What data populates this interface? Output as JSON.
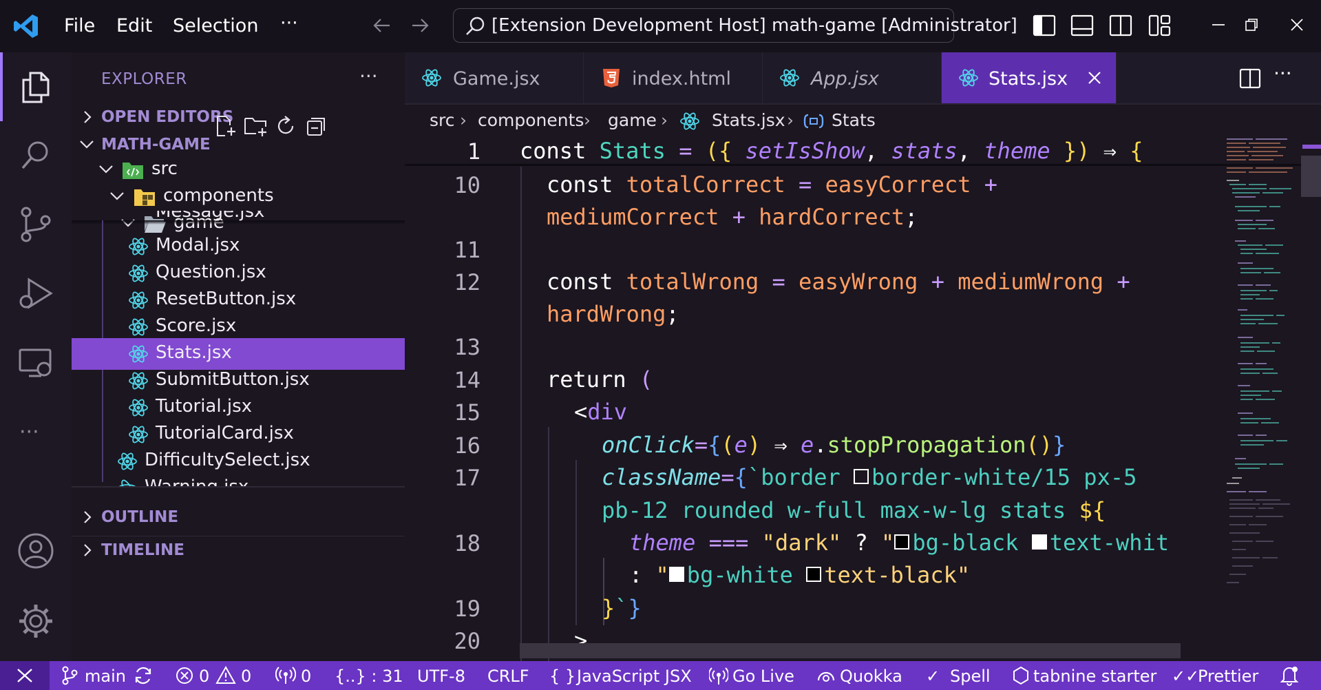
{
  "titlebar": {
    "menu": [
      "File",
      "Edit",
      "Selection"
    ],
    "more": "···",
    "command_center": "[Extension Development Host] math-game [Administrator]"
  },
  "explorer": {
    "header": "EXPLORER",
    "more": "···",
    "open_editors": "OPEN EDITORS",
    "project": "MATH-GAME",
    "folders": {
      "src": "src",
      "components": "components",
      "game": "game"
    },
    "files": [
      {
        "name": "Message.jsx"
      },
      {
        "name": "Modal.jsx"
      },
      {
        "name": "Question.jsx"
      },
      {
        "name": "ResetButton.jsx"
      },
      {
        "name": "Score.jsx"
      },
      {
        "name": "Stats.jsx"
      },
      {
        "name": "SubmitButton.jsx"
      },
      {
        "name": "Tutorial.jsx"
      },
      {
        "name": "TutorialCard.jsx"
      },
      {
        "name": "DifficultySelect.jsx"
      },
      {
        "name": "Warning.jsx"
      }
    ],
    "selected_file": "Stats.jsx",
    "outline": "OUTLINE",
    "timeline": "TIMELINE"
  },
  "tabs": [
    {
      "label": "Game.jsx",
      "icon": "react-icon"
    },
    {
      "label": "index.html",
      "icon": "html5-icon"
    },
    {
      "label": "App.jsx",
      "icon": "react-icon"
    },
    {
      "label": "Stats.jsx",
      "icon": "react-icon",
      "active": true
    }
  ],
  "breadcrumb": [
    "src",
    "components",
    "game",
    "Stats.jsx",
    "Stats"
  ],
  "code": {
    "line_numbers": [
      "1",
      "10",
      "11",
      "12",
      "13",
      "14",
      "15",
      "16",
      "17",
      "18",
      "19",
      "20"
    ],
    "l1": {
      "const": "const",
      "name": "Stats",
      "eq": "=",
      "open": "({",
      "p1": "setIsShow",
      "p2": "stats",
      "p3": "theme",
      "close": "})",
      "arrow": "⇒",
      "brace": "{"
    },
    "l10": {
      "const": "const",
      "name": "totalCorrect",
      "eq": "=",
      "a": "easyCorrect",
      "plus": "+",
      "b": "mediumCorrect",
      "c": "hardCorrect",
      "semi": ";"
    },
    "l12": {
      "const": "const",
      "name": "totalWrong",
      "eq": "=",
      "a": "easyWrong",
      "plus": "+",
      "b": "mediumWrong",
      "c": "hardWrong",
      "semi": ";"
    },
    "l14": {
      "ret": "return",
      "paren": "("
    },
    "l15": {
      "lt": "<",
      "tag": "div"
    },
    "l16": {
      "attr": "onClick",
      "eq": "=",
      "ob": "{",
      "op": "(",
      "e": "e",
      "cp": ")",
      "arrow": "⇒",
      "e2": "e",
      "dot": ".",
      "method": "stopPropagation",
      "call": "()",
      "cb": "}"
    },
    "l17": {
      "attr": "className",
      "eq": "=",
      "ob": "{",
      "tick": "`",
      "cls1": "border",
      "cls2": "border-white/15 px-5",
      "cls3": "pb-12 rounded w-full max-w-lg stats",
      "interp": "${"
    },
    "l18": {
      "theme": "theme",
      "eqeq": "===",
      "dark": "\"dark\"",
      "q": "?",
      "quote": "\"",
      "bg": "bg-black",
      "txt": "text-whit",
      "colon": ":",
      "bgw": "bg-white",
      "txtb": "text-black\""
    },
    "l19": {
      "cb": "}",
      "tick": "`",
      "cb2": "}"
    },
    "l20": {
      "gt": ">"
    }
  },
  "statusbar": {
    "branch": "main",
    "errors": "0",
    "warnings": "0",
    "ports": "0",
    "json": "{..} : 31",
    "encoding": "UTF-8",
    "eol": "CRLF",
    "language": "JavaScript JSX",
    "golive": "Go Live",
    "quokka": "Quokka",
    "spell": "Spell",
    "tabnine": "tabnine starter",
    "prettier": "Prettier"
  }
}
